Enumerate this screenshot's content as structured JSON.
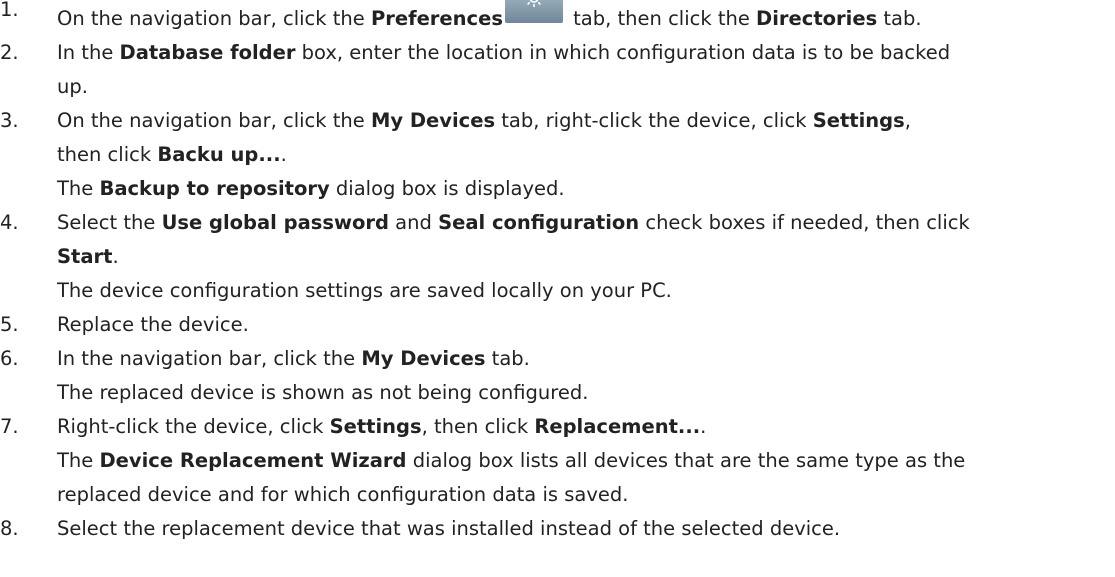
{
  "steps": [
    {
      "num": "1.",
      "parts": [
        "On the navigation bar, click the ",
        "Preferences",
        " tab, then click the ",
        "Directories",
        " tab."
      ]
    },
    {
      "num": "2.",
      "line1": [
        "In the ",
        "Database folder",
        " box, enter the location in which configuration data is to be backed"
      ],
      "line2": "up."
    },
    {
      "num": "3.",
      "line1": [
        "On the navigation bar, click the ",
        "My Devices",
        " tab, right-click the device, click ",
        "Settings",
        ","
      ],
      "line2": [
        "then click ",
        "Backu up...",
        "."
      ],
      "result": [
        "The ",
        "Backup to repository",
        " dialog box is displayed."
      ]
    },
    {
      "num": "4.",
      "line1": [
        "Select the ",
        "Use global password",
        " and ",
        "Seal configuration",
        " check boxes if needed, then click"
      ],
      "line2": [
        "Start",
        "."
      ],
      "result": "The device configuration settings are saved locally on your PC."
    },
    {
      "num": "5.",
      "text": "Replace the device."
    },
    {
      "num": "6.",
      "line1": [
        "In the navigation bar, click the ",
        "My Devices",
        " tab."
      ],
      "result": "The replaced device is shown as not being configured."
    },
    {
      "num": "7.",
      "line1": [
        "Right-click the device, click ",
        "Settings",
        ", then click ",
        "Replacement...",
        "."
      ],
      "result1": [
        "The ",
        "Device Replacement Wizard",
        " dialog box lists all devices that are the same type as the"
      ],
      "result2": "replaced device and for which configuration data is saved."
    },
    {
      "num": "8.",
      "text": "Select the replacement device that was installed instead of the selected device."
    }
  ],
  "icons": {
    "preferences": "gear-icon"
  },
  "colors": {
    "text": "#222222",
    "icon_bg": "#8aa0b0"
  }
}
